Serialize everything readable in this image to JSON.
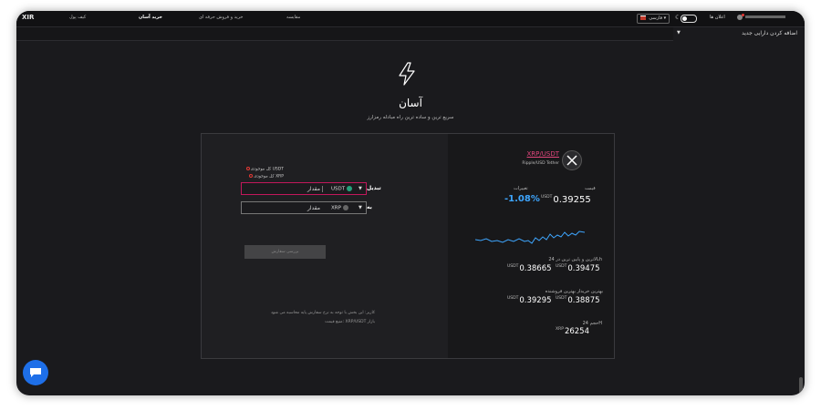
{
  "topbar": {
    "logo": "XIR",
    "nav": [
      "کیف پول",
      "خرید آسان",
      "خرید و فروش حرفه ای",
      "مقایسه"
    ],
    "active_nav": "خرید آسان",
    "language": "فارسی",
    "notifications": "اعلان ها"
  },
  "sidebar": {
    "add_asset": "اضافه کردن دارایی جدید"
  },
  "hero": {
    "title": "آسان",
    "subtitle": "سریع ترین و ساده ترین راه مبادله رمزارز"
  },
  "form": {
    "available_usdt": "کل موجودی USDT",
    "available_xrp": "کل موجودی XRP",
    "convert_label": "تبدیل",
    "to_label": "به",
    "amount_placeholder": "مقدار",
    "from_coin": "USDT",
    "to_coin": "XRP",
    "review_button": "بررسی سفارش",
    "note_line1": "کاربر: این بخش با توجه به نرخ سفارش پایه محاسبه می شود",
    "note_line2": "منبع قیمت: XRP/USDT بازار"
  },
  "market": {
    "pair": "XRP/USDT",
    "pair_name": "Ripple/USD Tether",
    "price_label": "قیمت",
    "change_label": "تغییرات",
    "price_unit": "USDT",
    "price": "0.39255",
    "change": "-1.08%",
    "high_low_label": "بالاترین و پایین ترین در 24h",
    "high": "0.39475",
    "low": "0.38665",
    "best_label": "بهترین خریدار بهترین فروشنده",
    "best_sell": "0.38875",
    "best_buy": "0.39295",
    "volume_label": "حجم 24H",
    "volume_unit": "XRP",
    "volume": "26254"
  },
  "colors": {
    "accent": "#c2185b",
    "link": "#e0457b",
    "change": "#3ea6ff",
    "chat": "#1e6fe8"
  }
}
